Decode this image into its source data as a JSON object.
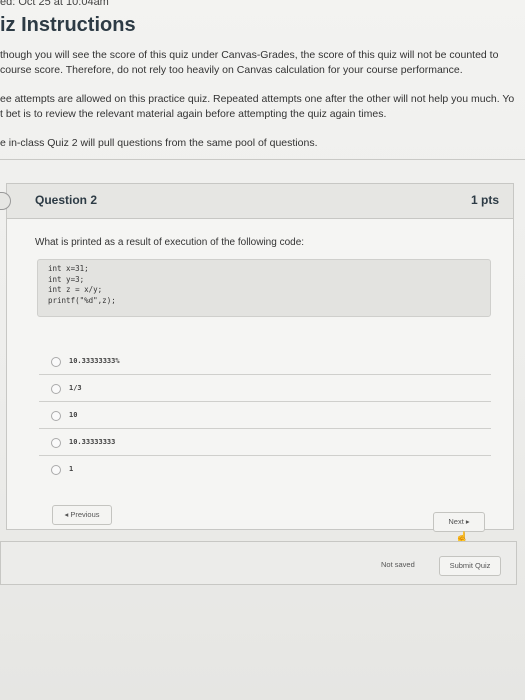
{
  "header": {
    "due": "ed: Oct 25 at 10:04am",
    "title": "iz Instructions"
  },
  "instructions": {
    "lines": [
      " though you will see the score of this quiz under Canvas-Grades, the score of this quiz will not be counted to",
      " course score. Therefore, do not rely too heavily on Canvas calculation for your course performance.",
      "ee attempts are allowed on this practice quiz. Repeated attempts one after the other will not help you much. Yo",
      "t bet is to review the relevant material again before attempting the quiz again times.",
      "e in-class Quiz 2 will pull questions from the same pool of questions."
    ]
  },
  "question": {
    "title": "Question 2",
    "points": "1 pts",
    "text": "What is printed as a result of execution of the following code:",
    "code": [
      "int x=31;",
      "int y=3;",
      "int z = x/y;",
      "printf(\"%d\",z);"
    ],
    "answers": [
      "10.33333333%",
      "1/3",
      "10",
      "10.33333333",
      "1"
    ]
  },
  "nav": {
    "previous": "◂ Previous",
    "next": "Next ▸"
  },
  "footer": {
    "status": "Not saved",
    "submit": "Submit Quiz"
  }
}
